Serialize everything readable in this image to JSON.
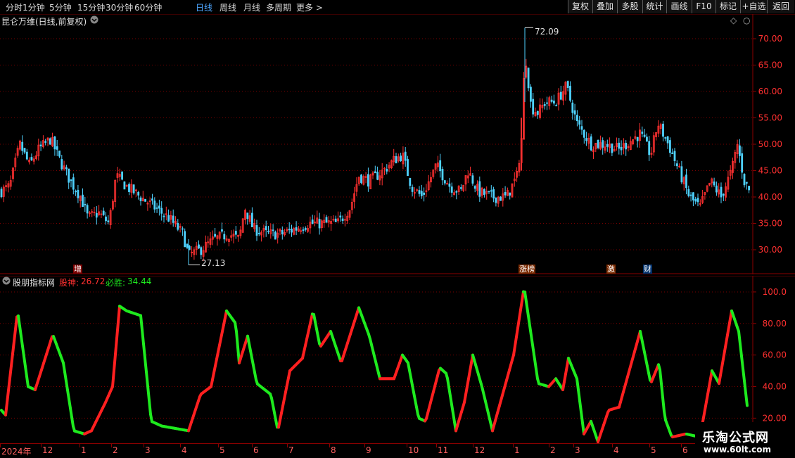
{
  "toolbar": {
    "periods": [
      "分时",
      "1分钟",
      "5分钟",
      "15分钟",
      "30分钟",
      "60分钟",
      "日线",
      "周线",
      "月线",
      "多周期",
      "更多 >"
    ],
    "active_period": "日线",
    "buttons": [
      "复权",
      "叠加",
      "多股",
      "统计",
      "画线",
      "F10",
      "标记",
      "+自选",
      "返回"
    ]
  },
  "main_panel": {
    "title": "昆仑万维(日线,前复权)",
    "price_axis_labels": [
      "70.00",
      "65.00",
      "60.00",
      "55.00",
      "50.00",
      "45.00",
      "40.00",
      "35.00",
      "30.00"
    ],
    "high_label": "72.09",
    "low_label": "27.13",
    "markers": [
      {
        "text": "增",
        "color": "#ff4040"
      },
      {
        "text": "涨榜",
        "color": "#ff8c40"
      },
      {
        "text": "激",
        "color": "#ff8c40"
      },
      {
        "text": "财",
        "color": "#4da6ff"
      }
    ],
    "colors": {
      "up": "#ff3030",
      "down": "#4fd2ff",
      "grid": "#8b0000"
    }
  },
  "sub_panel": {
    "name": "股朋指标网",
    "line1_label": "股神:",
    "line1_value": "26.72",
    "line2_label": "必胜:",
    "line2_value": "34.44",
    "axis_labels": [
      "100.0",
      "80.00",
      "60.00",
      "40.00",
      "20.00"
    ],
    "colors": {
      "rising": "#ff2020",
      "falling": "#1eea1e"
    }
  },
  "time_axis": [
    "2024年",
    "12",
    "1",
    "2",
    "3",
    "4",
    "5",
    "6",
    "7",
    "8",
    "9",
    "10",
    "11",
    "12",
    "1",
    "2",
    "3",
    "4",
    "5",
    "6"
  ],
  "watermark": {
    "title": "乐淘公式网",
    "url": "www.60lt.com"
  },
  "chart_data": [
    {
      "type": "candlestick",
      "title": "昆仑万维(日线,前复权)",
      "y_range": [
        26,
        74
      ],
      "annotations": [
        {
          "label": "72.09",
          "value": 72.09
        },
        {
          "label": "27.13",
          "value": 27.13
        }
      ],
      "close_path_approx": [
        {
          "x": "2024-01",
          "v": 41
        },
        {
          "x": "2024-01",
          "v": 50
        },
        {
          "x": "2024-01",
          "v": 47
        },
        {
          "x": "2024-02",
          "v": 51
        },
        {
          "x": "2024-02",
          "v": 45
        },
        {
          "x": "2024-02",
          "v": 37
        },
        {
          "x": "2024-03",
          "v": 44
        },
        {
          "x": "2024-03",
          "v": 40
        },
        {
          "x": "2024-04",
          "v": 37
        },
        {
          "x": "2024-04",
          "v": 31
        },
        {
          "x": "2024-05",
          "v": 33
        },
        {
          "x": "2024-05",
          "v": 36
        },
        {
          "x": "2024-06",
          "v": 34
        },
        {
          "x": "2024-07",
          "v": 35
        },
        {
          "x": "2024-08",
          "v": 37
        },
        {
          "x": "2024-09",
          "v": 44
        },
        {
          "x": "2024-09",
          "v": 48
        },
        {
          "x": "2024-10",
          "v": 42
        },
        {
          "x": "2024-10",
          "v": 45
        },
        {
          "x": "2024-11",
          "v": 42
        },
        {
          "x": "2024-11",
          "v": 40
        },
        {
          "x": "2025-01",
          "v": 66
        },
        {
          "x": "2025-01",
          "v": 55
        },
        {
          "x": "2025-02",
          "v": 60
        },
        {
          "x": "2025-02",
          "v": 55
        },
        {
          "x": "2025-03",
          "v": 49
        },
        {
          "x": "2025-04",
          "v": 52
        },
        {
          "x": "2025-04",
          "v": 54
        },
        {
          "x": "2025-05",
          "v": 44
        },
        {
          "x": "2025-05",
          "v": 38
        },
        {
          "x": "2025-06",
          "v": 48
        },
        {
          "x": "2025-06",
          "v": 40
        }
      ]
    },
    {
      "type": "line",
      "series": [
        {
          "name": "股神",
          "last_value": 26.72
        },
        {
          "name": "必胜",
          "last_value": 34.44
        }
      ],
      "y_range": [
        5,
        108
      ],
      "approx_values": [
        25,
        88,
        40,
        73,
        12,
        30,
        91,
        88,
        18,
        15,
        38,
        88,
        45,
        72,
        38,
        50,
        88,
        55,
        50,
        90,
        72,
        45,
        63,
        35,
        15,
        52,
        20,
        60,
        18,
        58,
        15,
        103,
        42,
        45,
        40,
        58,
        15,
        25,
        30,
        15,
        75,
        40,
        55,
        10,
        10,
        5,
        50,
        42,
        88,
        28
      ]
    }
  ]
}
